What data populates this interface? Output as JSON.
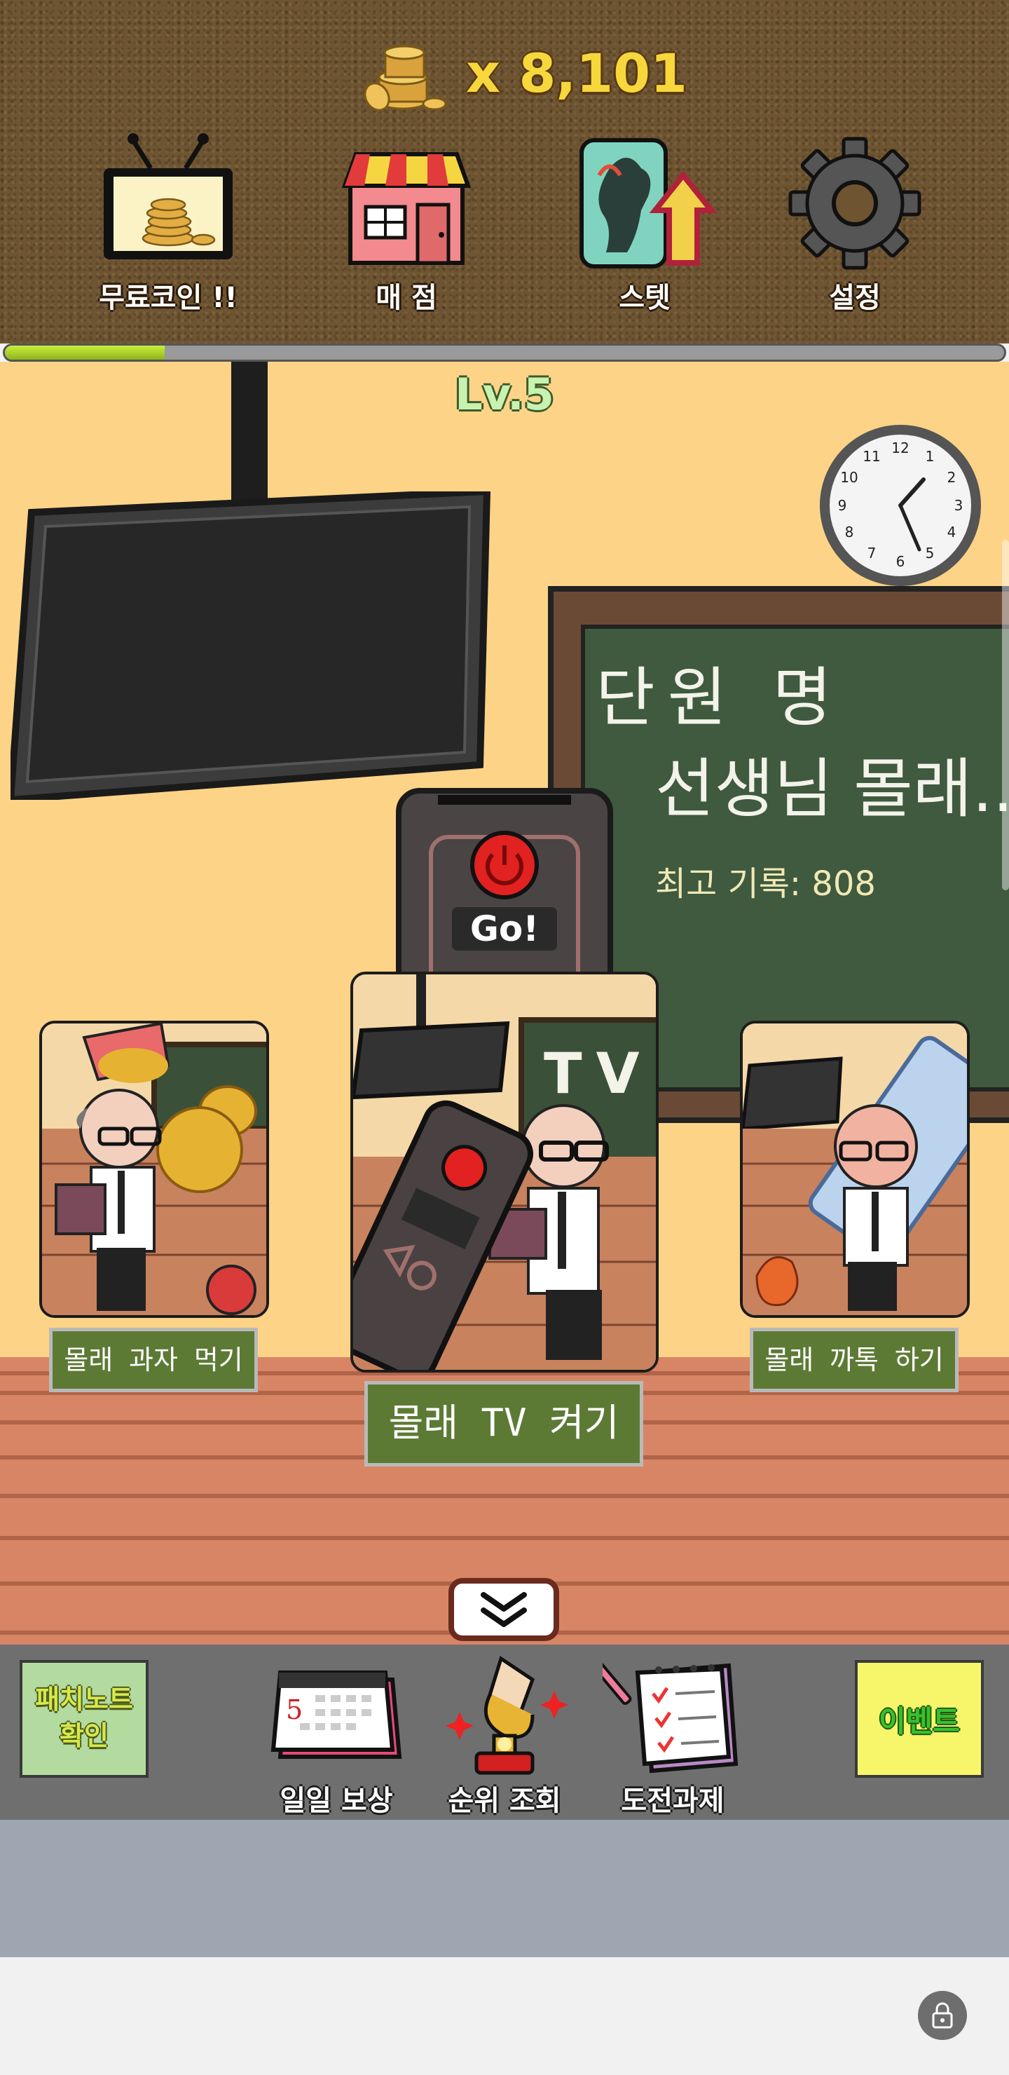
{
  "hud": {
    "coin_count": "x 8,101",
    "buttons": [
      {
        "label": "무료코인 !!",
        "icon": "tv-coins-icon"
      },
      {
        "label": "매 점",
        "icon": "shop-icon"
      },
      {
        "label": "스텟",
        "icon": "stat-upgrade-icon"
      },
      {
        "label": "설정",
        "icon": "gear-icon"
      }
    ],
    "level_progress": 0.16
  },
  "scene": {
    "level": "Lv.5",
    "chalkboard": {
      "title": "단원 명",
      "subtitle": "선생님 몰래...",
      "best_record": "최고 기록: 808"
    },
    "go_button": "Go!",
    "stages": [
      {
        "label": "몰래 과자 먹기"
      },
      {
        "label": "몰래 TV 켜기",
        "card_text": "TV"
      },
      {
        "label": "몰래 까톡 하기"
      }
    ]
  },
  "bottom_bar": {
    "patch_note": "패치노트\n확인",
    "patch_note_line1": "패치노트",
    "patch_note_line2": "확인",
    "buttons": [
      {
        "label": "일일 보상",
        "icon": "calendar-icon"
      },
      {
        "label": "순위 조회",
        "icon": "trophy-icon"
      },
      {
        "label": "도전과제",
        "icon": "checklist-icon"
      }
    ],
    "event": "이벤트",
    "calendar_day": "5"
  },
  "colors": {
    "hud_bg": "#6e5430",
    "coin_text": "#f7d83c",
    "wall": "#fdd387",
    "chalkboard": "#3f5a3e",
    "stage_label_bg": "#5d7a35",
    "progress_fill": "#a9d42a"
  }
}
